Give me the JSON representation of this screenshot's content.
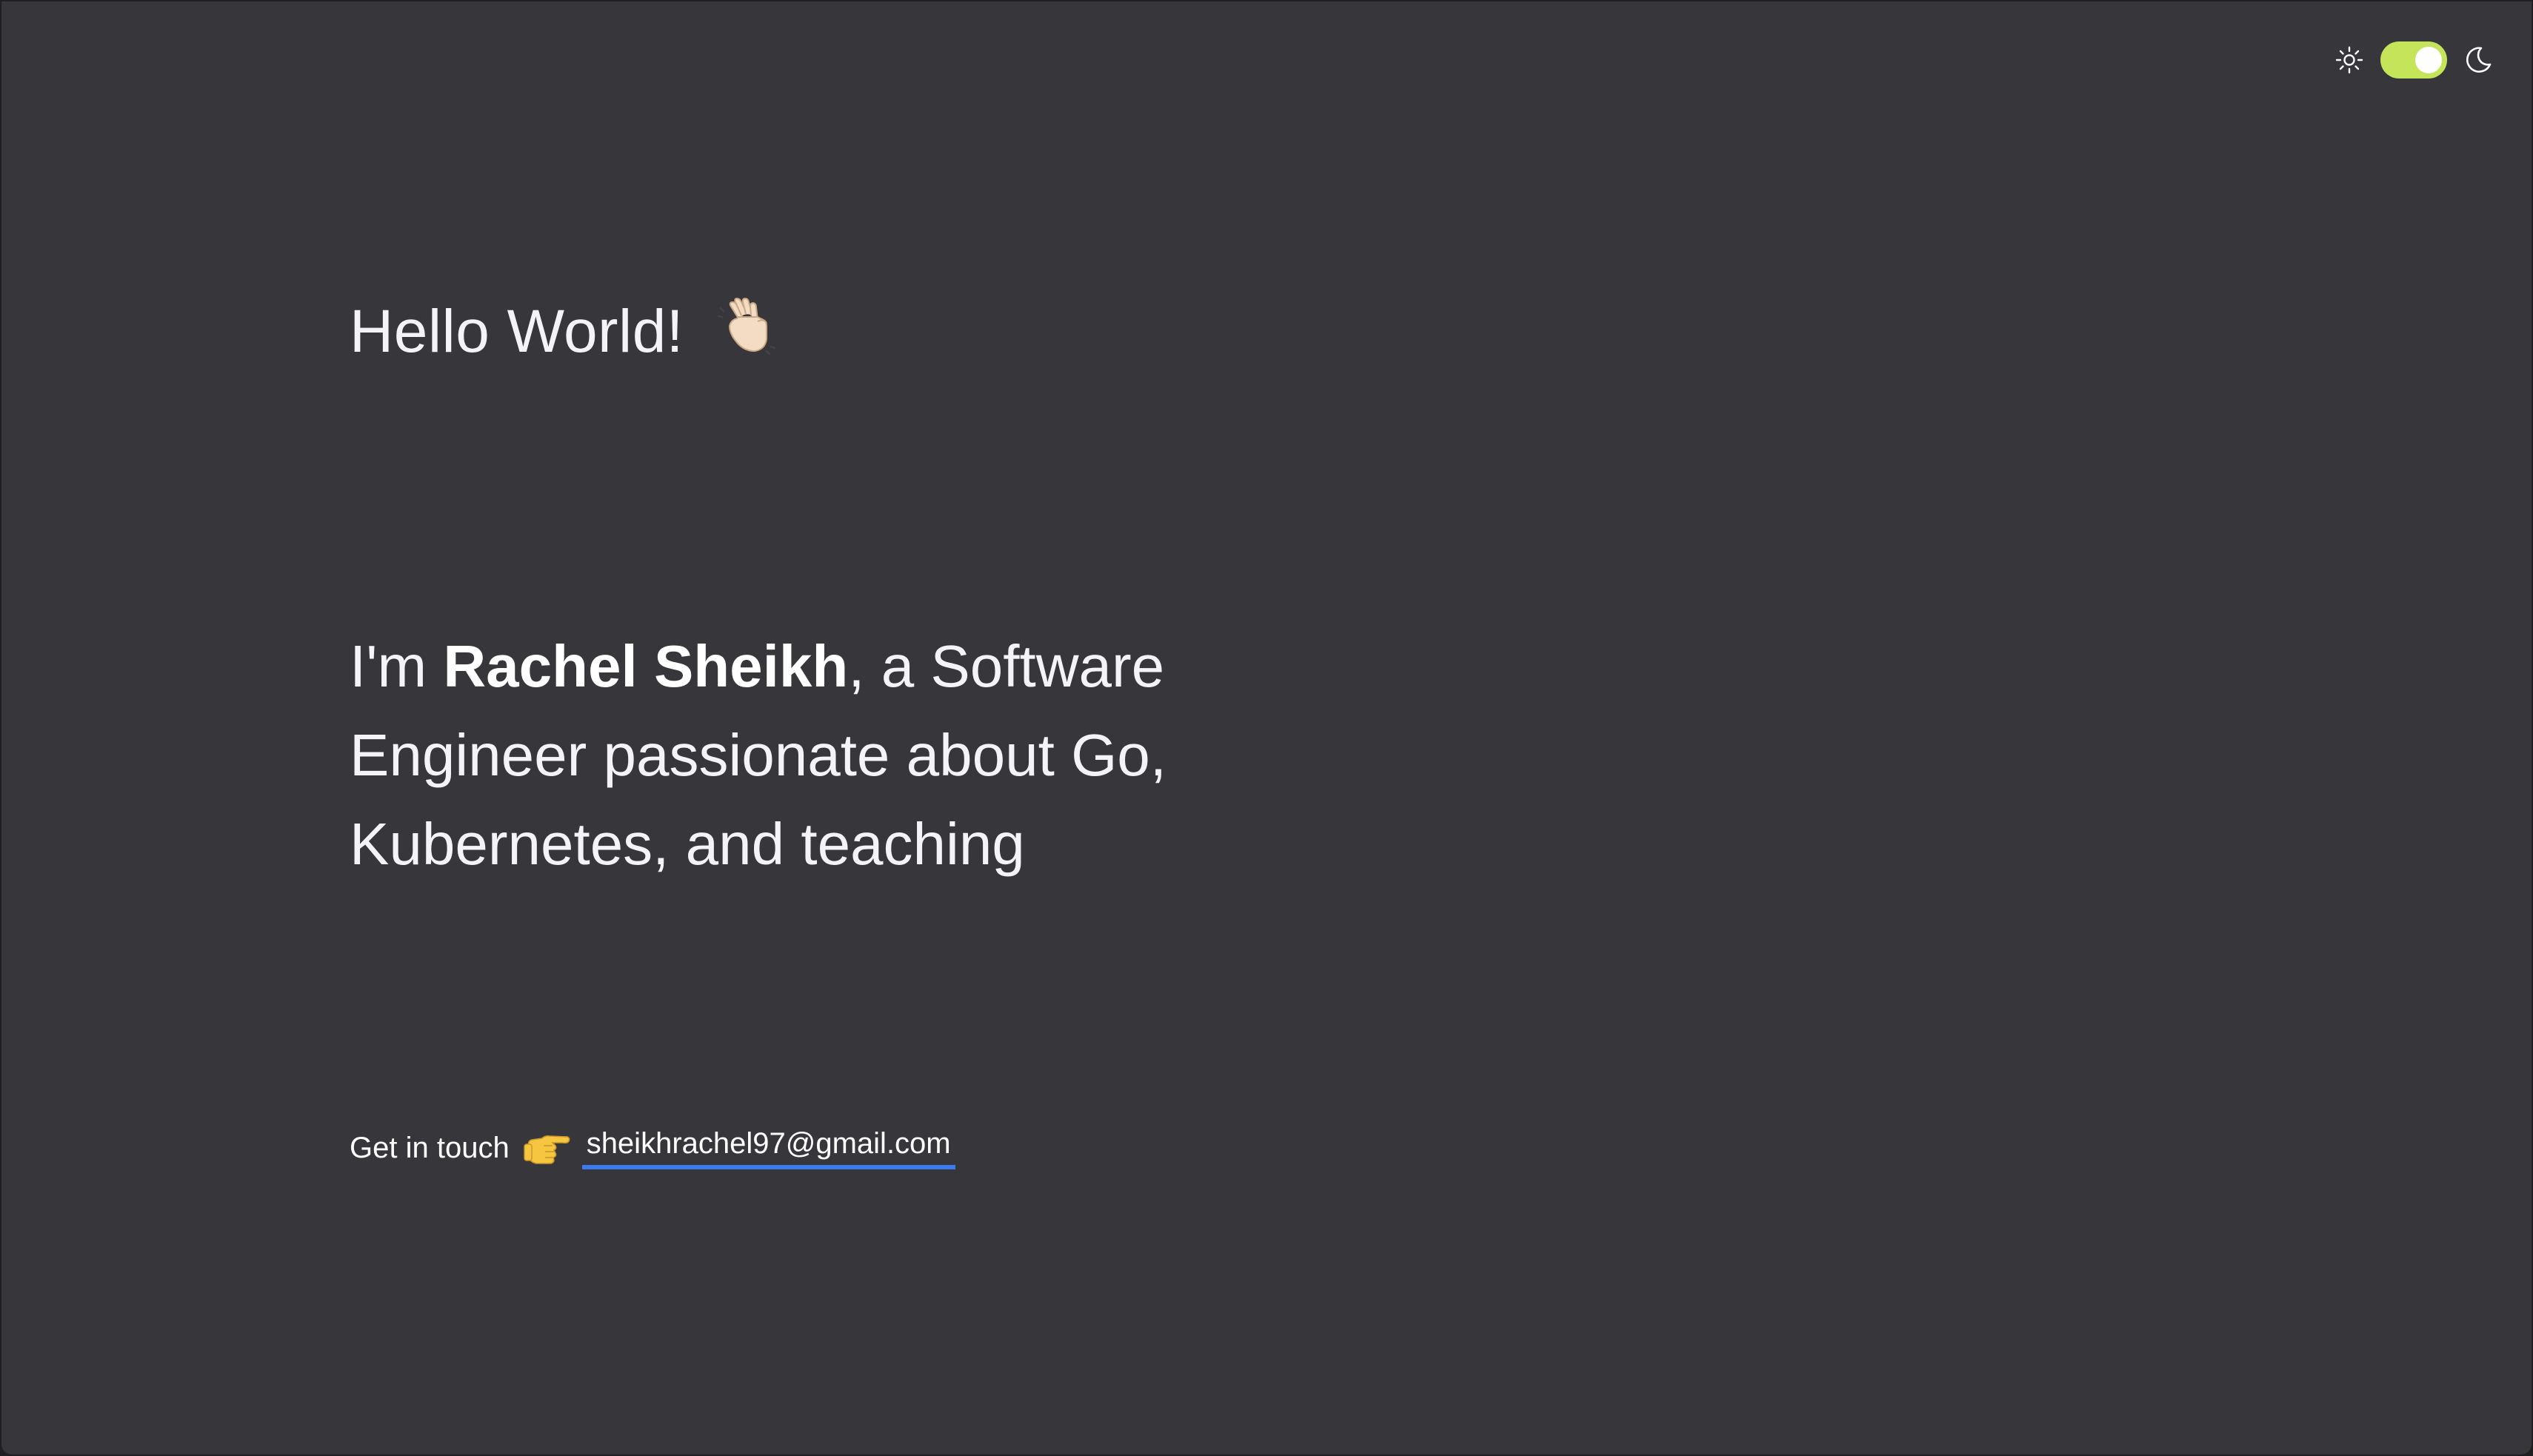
{
  "theme_toggle": {
    "left_icon": "sun-icon",
    "right_icon": "moon-icon",
    "state": "dark",
    "accent_color": "#c4e55a"
  },
  "hero": {
    "greeting": "Hello World!",
    "greeting_icon": "waving-hand-icon",
    "intro_prefix": "I'm ",
    "name": "Rachel Sheikh",
    "intro_suffix": ", a Software Engineer passionate about Go, Kubernetes, and teaching"
  },
  "contact": {
    "label": "Get in touch",
    "label_icon": "pointing-right-icon",
    "email": "sheikhrachel97@gmail.com",
    "link_underline_color": "#3b7bef"
  },
  "colors": {
    "background": "#37363b",
    "text": "#ffffff"
  }
}
